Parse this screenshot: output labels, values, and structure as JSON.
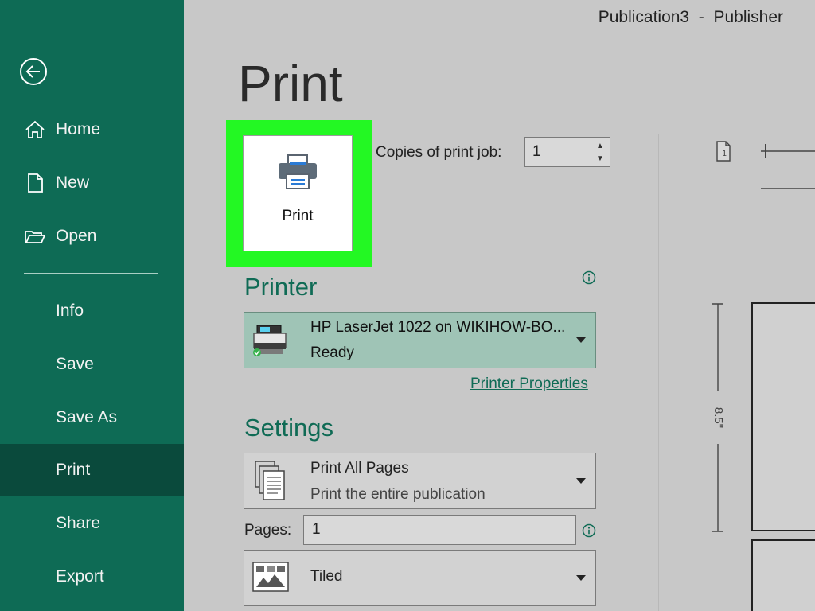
{
  "window": {
    "title": "Publication3  -  Publisher"
  },
  "sidebar": {
    "back_icon": "back-arrow-icon",
    "items": [
      {
        "label": "Home",
        "icon": "home-icon"
      },
      {
        "label": "New",
        "icon": "new-document-icon"
      },
      {
        "label": "Open",
        "icon": "open-folder-icon"
      },
      {
        "label": "Info"
      },
      {
        "label": "Save"
      },
      {
        "label": "Save As"
      },
      {
        "label": "Print",
        "active": true
      },
      {
        "label": "Share"
      },
      {
        "label": "Export"
      }
    ]
  },
  "main": {
    "title": "Print",
    "print_button": {
      "label": "Print",
      "icon": "printer-icon"
    },
    "copies": {
      "label": "Copies of print job:",
      "value": "1"
    },
    "printer": {
      "heading": "Printer",
      "name": "HP LaserJet 1022 on WIKIHOW-BO...",
      "status": "Ready",
      "properties_link": "Printer Properties"
    },
    "settings": {
      "heading": "Settings",
      "pages_option": {
        "title": "Print All Pages",
        "subtitle": "Print the entire publication"
      },
      "pages_label": "Pages:",
      "pages_value": "1",
      "layout_option": {
        "title": "Tiled"
      }
    },
    "preview": {
      "height_label": "8.5\""
    }
  },
  "colors": {
    "sidebar": "#0e6b55",
    "sidebar_active": "#0a4a3c",
    "accent": "#0f6b55",
    "highlight": "#23f823",
    "background": "#c8c8c8"
  }
}
